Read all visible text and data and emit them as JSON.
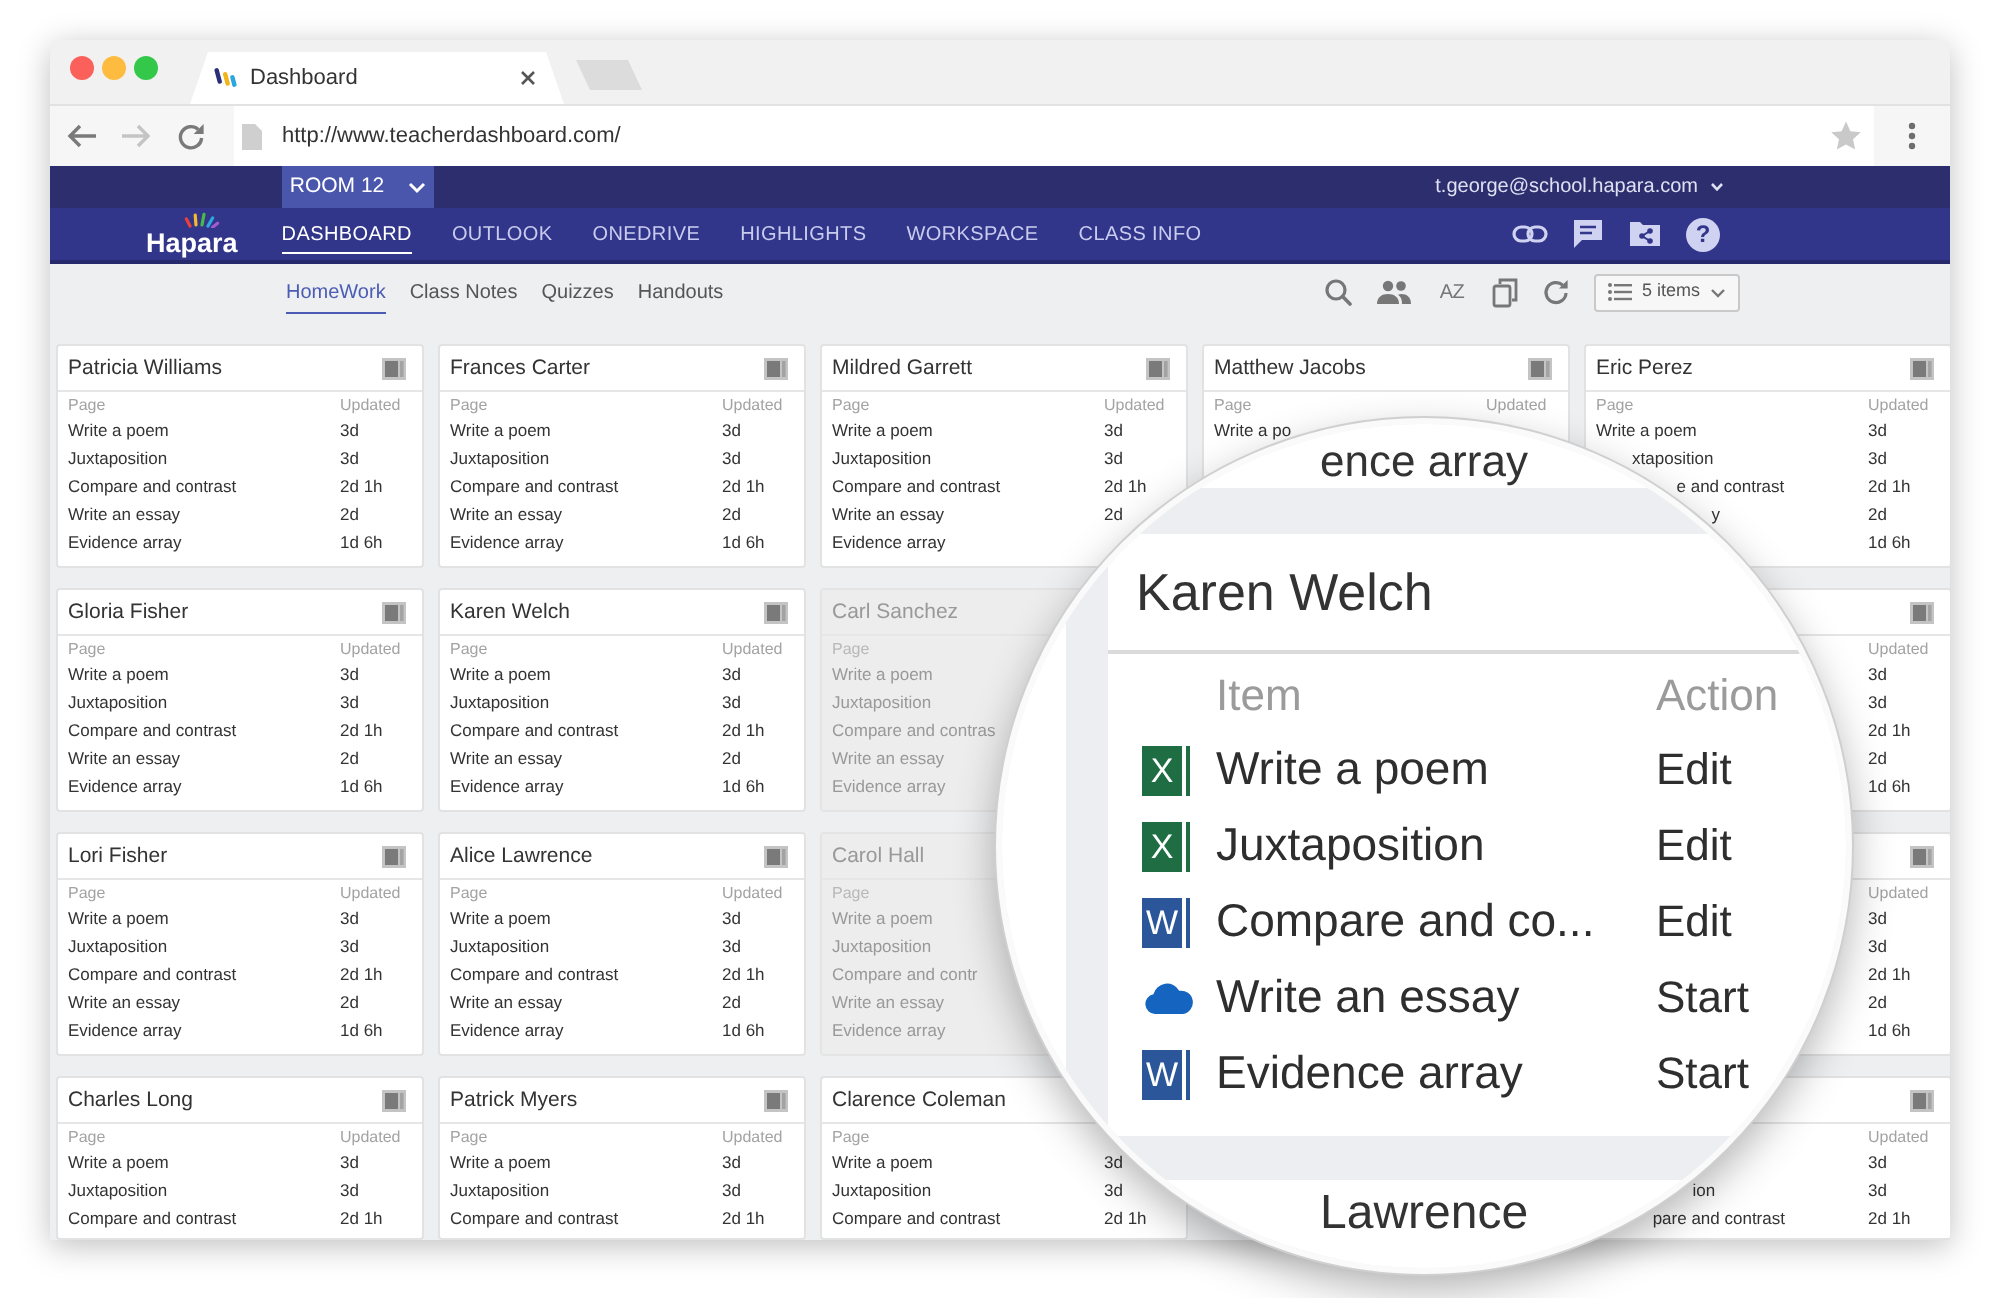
{
  "browser": {
    "tab": "Dashboard",
    "url": "http://www.teacherdashboard.com/"
  },
  "app": {
    "room": "ROOM 12",
    "user": "t.george@school.hapara.com",
    "logo": "Hapara",
    "nav": [
      {
        "label": "DASHBOARD",
        "selected": true
      },
      {
        "label": "OUTLOOK",
        "selected": false
      },
      {
        "label": "ONEDRIVE",
        "selected": false
      },
      {
        "label": "HIGHLIGHTS",
        "selected": false
      },
      {
        "label": "WORKSPACE",
        "selected": false
      },
      {
        "label": "CLASS INFO",
        "selected": false
      }
    ],
    "help": "?"
  },
  "subnav": {
    "tabs": [
      {
        "label": "HomeWork",
        "selected": true
      },
      {
        "label": "Class Notes",
        "selected": false
      },
      {
        "label": "Quizzes",
        "selected": false
      },
      {
        "label": "Handouts",
        "selected": false
      }
    ],
    "sort": "AZ",
    "items": "5 items"
  },
  "card_columns": [
    [
      {
        "name": "Patricia Williams",
        "dimmed": false,
        "headers": {
          "page": "Page",
          "updated": "Updated"
        },
        "rows": [
          {
            "page": "Write a poem",
            "updated": "3d"
          },
          {
            "page": "Juxtaposition",
            "updated": "3d"
          },
          {
            "page": "Compare and contrast",
            "updated": "2d 1h"
          },
          {
            "page": "Write an essay",
            "updated": "2d"
          },
          {
            "page": "Evidence array",
            "updated": "1d 6h"
          }
        ]
      },
      {
        "name": "Gloria Fisher",
        "dimmed": false,
        "headers": {
          "page": "Page",
          "updated": "Updated"
        },
        "rows": [
          {
            "page": "Write a poem",
            "updated": "3d"
          },
          {
            "page": "Juxtaposition",
            "updated": "3d"
          },
          {
            "page": "Compare and contrast",
            "updated": "2d 1h"
          },
          {
            "page": "Write an essay",
            "updated": "2d"
          },
          {
            "page": "Evidence array",
            "updated": "1d 6h"
          }
        ]
      },
      {
        "name": "Lori Fisher",
        "dimmed": false,
        "headers": {
          "page": "Page",
          "updated": "Updated"
        },
        "rows": [
          {
            "page": "Write a poem",
            "updated": "3d"
          },
          {
            "page": "Juxtaposition",
            "updated": "3d"
          },
          {
            "page": "Compare and contrast",
            "updated": "2d 1h"
          },
          {
            "page": "Write an essay",
            "updated": "2d"
          },
          {
            "page": "Evidence array",
            "updated": "1d 6h"
          }
        ]
      },
      {
        "name": "Charles Long",
        "dimmed": false,
        "headers": {
          "page": "Page",
          "updated": "Updated"
        },
        "rows": [
          {
            "page": "Write a poem",
            "updated": "3d"
          },
          {
            "page": "Juxtaposition",
            "updated": "3d"
          },
          {
            "page": "Compare and contrast",
            "updated": "2d 1h"
          }
        ]
      }
    ],
    [
      {
        "name": "Frances Carter",
        "dimmed": false,
        "headers": {
          "page": "Page",
          "updated": "Updated"
        },
        "rows": [
          {
            "page": "Write a poem",
            "updated": "3d"
          },
          {
            "page": "Juxtaposition",
            "updated": "3d"
          },
          {
            "page": "Compare and contrast",
            "updated": "2d 1h"
          },
          {
            "page": "Write an essay",
            "updated": "2d"
          },
          {
            "page": "Evidence array",
            "updated": "1d 6h"
          }
        ]
      },
      {
        "name": "Karen Welch",
        "dimmed": false,
        "headers": {
          "page": "Page",
          "updated": "Updated"
        },
        "rows": [
          {
            "page": "Write a poem",
            "updated": "3d"
          },
          {
            "page": "Juxtaposition",
            "updated": "3d"
          },
          {
            "page": "Compare and contrast",
            "updated": "2d 1h"
          },
          {
            "page": "Write an essay",
            "updated": "2d"
          },
          {
            "page": "Evidence array",
            "updated": "1d 6h"
          }
        ]
      },
      {
        "name": "Alice Lawrence",
        "dimmed": false,
        "headers": {
          "page": "Page",
          "updated": "Updated"
        },
        "rows": [
          {
            "page": "Write a poem",
            "updated": "3d"
          },
          {
            "page": "Juxtaposition",
            "updated": "3d"
          },
          {
            "page": "Compare and contrast",
            "updated": "2d 1h"
          },
          {
            "page": "Write an essay",
            "updated": "2d"
          },
          {
            "page": "Evidence array",
            "updated": "1d 6h"
          }
        ]
      },
      {
        "name": "Patrick Myers",
        "dimmed": false,
        "headers": {
          "page": "Page",
          "updated": "Updated"
        },
        "rows": [
          {
            "page": "Write a poem",
            "updated": "3d"
          },
          {
            "page": "Juxtaposition",
            "updated": "3d"
          },
          {
            "page": "Compare and contrast",
            "updated": "2d 1h"
          }
        ]
      }
    ],
    [
      {
        "name": "Mildred Garrett",
        "dimmed": false,
        "headers": {
          "page": "Page",
          "updated": "Updated"
        },
        "rows": [
          {
            "page": "Write a poem",
            "updated": "3d"
          },
          {
            "page": "Juxtaposition",
            "updated": "3d"
          },
          {
            "page": "Compare and contrast",
            "updated": "2d 1h"
          },
          {
            "page": "Write an essay",
            "updated": "2d"
          },
          {
            "page": "Evidence array"
          }
        ]
      },
      {
        "name": "Carl Sanchez",
        "dimmed": true,
        "headers": {
          "page": "Page"
        },
        "rows": [
          {
            "page": "Write a poem"
          },
          {
            "page": "Juxtaposition"
          },
          {
            "page": "Compare and contras"
          },
          {
            "page": "Write an essay"
          },
          {
            "page": "Evidence array"
          }
        ]
      },
      {
        "name": "Carol Hall",
        "dimmed": true,
        "headers": {
          "page": "Page"
        },
        "rows": [
          {
            "page": "Write a poem"
          },
          {
            "page": "Juxtaposition"
          },
          {
            "page": "Compare and contr"
          },
          {
            "page": "Write an essay"
          },
          {
            "page": "Evidence array"
          }
        ]
      },
      {
        "name": "Clarence Coleman",
        "dimmed": false,
        "headers": {
          "page": "Page"
        },
        "rows": [
          {
            "page": "Write a poem",
            "updated": "3d"
          },
          {
            "page": "Juxtaposition",
            "updated": "3d"
          },
          {
            "page": "Compare and contrast",
            "updated": "2d 1h"
          }
        ]
      }
    ],
    [
      {
        "name": "Matthew Jacobs",
        "dimmed": false,
        "headers": {
          "page": "Page",
          "updated": "Updated"
        },
        "rows": [
          {
            "page": "Write a po"
          }
        ]
      }
    ],
    [
      {
        "name": "Eric Perez",
        "dimmed": false,
        "headers": {
          "page": "Page",
          "updated": "Updated"
        },
        "rows": [
          {
            "page": "Write a poem",
            "updated": "3d"
          },
          {
            "page": "xtaposition",
            "updated": "3d"
          },
          {
            "page": "e and contrast",
            "updated": "2d 1h"
          },
          {
            "page": "y",
            "updated": "2d"
          },
          {
            "updated": "1d 6h"
          }
        ]
      },
      {
        "dimmed": false,
        "headers": {
          "updated": "Updated"
        },
        "rows": [
          {
            "updated": "3d"
          },
          {
            "updated": "3d"
          },
          {
            "updated": "2d 1h"
          },
          {
            "updated": "2d"
          },
          {
            "updated": "1d 6h"
          }
        ]
      },
      {
        "dimmed": false,
        "headers": {
          "updated": "Updated"
        },
        "rows": [
          {
            "updated": "3d"
          },
          {
            "updated": "3d"
          },
          {
            "updated": "2d 1h"
          },
          {
            "updated": "2d"
          },
          {
            "updated": "1d 6h"
          }
        ]
      },
      {
        "dimmed": false,
        "headers": {
          "updated": "Updated"
        },
        "rows": [
          {
            "updated": "3d"
          },
          {
            "page": "ion",
            "updated": "3d"
          },
          {
            "page": "pare and contrast",
            "updated": "2d 1h"
          }
        ]
      }
    ]
  ],
  "magnifier": {
    "top_text": "ence array",
    "card": {
      "name": "Karen Welch",
      "item_header": "Item",
      "action_header": "Action",
      "rows": [
        {
          "kind": "spreadsheet",
          "glyph": "X",
          "item": "Write a poem",
          "action": "Edit"
        },
        {
          "kind": "spreadsheet",
          "glyph": "X",
          "item": "Juxtaposition",
          "action": "Edit"
        },
        {
          "kind": "document",
          "glyph": "W",
          "item": "Compare and co...",
          "action": "Edit"
        },
        {
          "kind": "cloud",
          "item": "Write an essay",
          "action": "Start"
        },
        {
          "kind": "document",
          "glyph": "W",
          "item": "Evidence array",
          "action": "Start"
        }
      ]
    },
    "bottom_text": "Lawrence"
  }
}
